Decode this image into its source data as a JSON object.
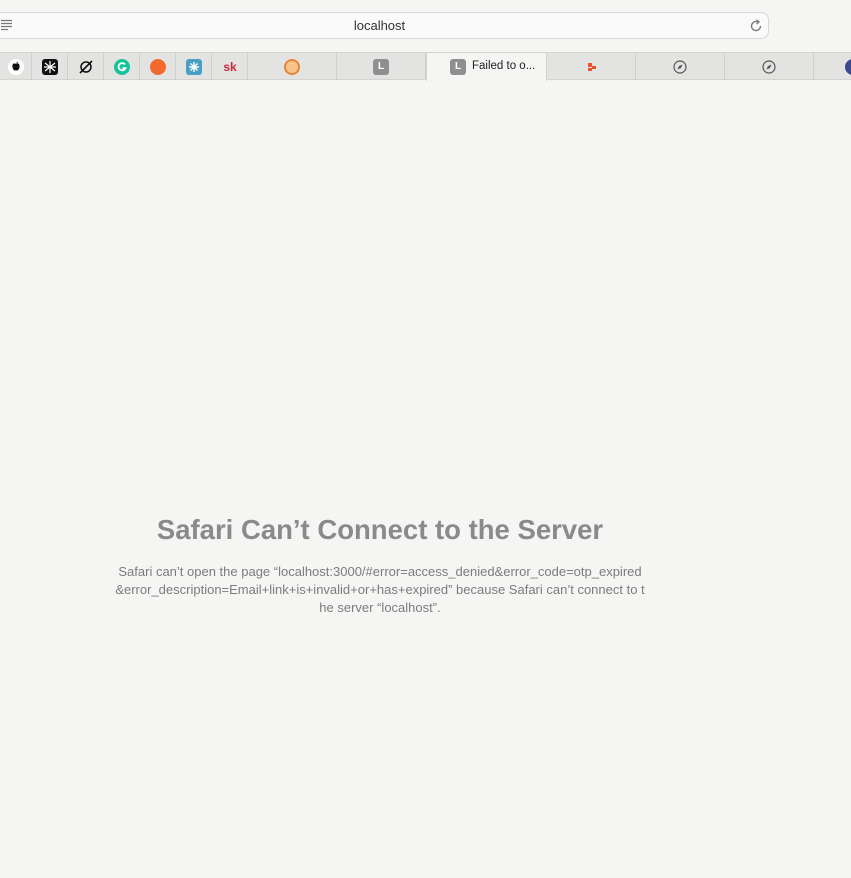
{
  "address_bar": {
    "url_text": "localhost"
  },
  "tabs": [
    {
      "name": "apple",
      "title": ""
    },
    {
      "name": "pattern",
      "title": ""
    },
    {
      "name": "slash",
      "title": ""
    },
    {
      "name": "grammarly",
      "title": ""
    },
    {
      "name": "orange",
      "title": ""
    },
    {
      "name": "teal",
      "title": ""
    },
    {
      "name": "sk",
      "icon_text": "sk",
      "title": ""
    },
    {
      "name": "target",
      "title": ""
    },
    {
      "name": "letter-l",
      "icon_text": "L",
      "title": ""
    },
    {
      "name": "failed",
      "icon_text": "L",
      "title": "Failed to o..."
    },
    {
      "name": "dots",
      "title": ""
    },
    {
      "name": "compass-1",
      "title": ""
    },
    {
      "name": "compass-2",
      "title": ""
    },
    {
      "name": "partial",
      "title": ""
    }
  ],
  "error": {
    "title": "Safari Can’t Connect to the Server",
    "message": "Safari can’t open the page “localhost:3000/#error=access_denied&error_code=otp_expired&error_description=Email+link+is+invalid+or+has+expired” because Safari can’t connect to the server “localhost”."
  },
  "icons": {
    "page_menu": "page-menu-icon",
    "reload": "reload-icon",
    "compass": "compass-icon"
  },
  "colors": {
    "background": "#f5f5f4",
    "error_title": "#8a8a8a",
    "error_message": "#7c7c7c",
    "tab_bar": "#e3e3e1"
  }
}
